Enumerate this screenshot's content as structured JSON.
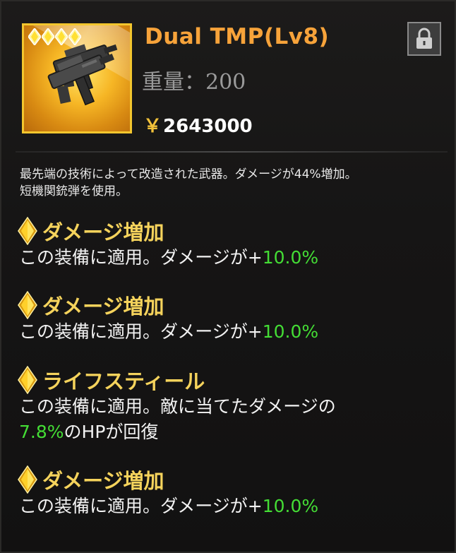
{
  "item": {
    "name": "Dual TMP(Lv8)",
    "weight": "重量：200",
    "price_symbol": "￥",
    "price": "2643000",
    "rarity_stars": 4,
    "image_icon": "dual-smg-icon",
    "lock_icon": "lock-icon"
  },
  "description": {
    "line1": "最先端の技術によって改造された武器。ダメージが44%増加。",
    "line2": "短機関銃弾を使用。"
  },
  "effects": [
    {
      "name": "ダメージ増加",
      "text": "この装備に適用。ダメージが+",
      "value": "10.0%",
      "text2": ""
    },
    {
      "name": "ダメージ増加",
      "text": "この装備に適用。ダメージが+",
      "value": "10.0%",
      "text2": ""
    },
    {
      "name": "ライフスティール",
      "text": "この装備に適用。敵に当てたダメージの",
      "value": "7.8%",
      "text2": "のHPが回復"
    },
    {
      "name": "ダメージ増加",
      "text": "この装備に適用。ダメージが+",
      "value": "10.0%",
      "text2": ""
    }
  ],
  "colors": {
    "title": "#f7a33a",
    "effect_name": "#f5d35c",
    "value_green": "#44dd35",
    "frame_gold": "#f3c62e"
  }
}
